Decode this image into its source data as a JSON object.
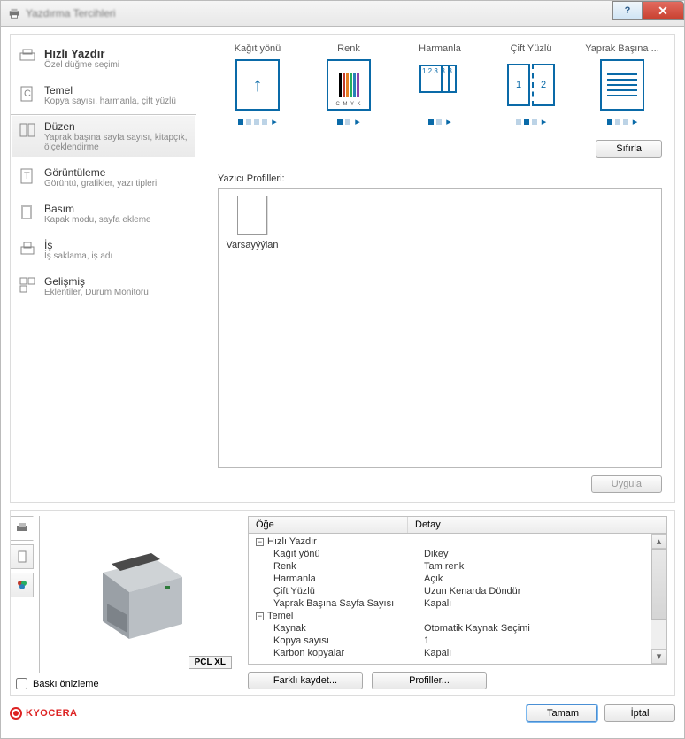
{
  "window": {
    "title": "Yazdırma Tercihleri"
  },
  "sidebar": {
    "items": [
      {
        "main": "Hızlı Yazdır",
        "sub": "Özel düğme seçimi"
      },
      {
        "main": "Temel",
        "sub": "Kopya sayısı, harmanla, çift yüzlü"
      },
      {
        "main": "Düzen",
        "sub": "Yaprak başına sayfa sayısı, kitapçık, ölçeklendirme"
      },
      {
        "main": "Görüntüleme",
        "sub": "Görüntü, grafikler, yazı tipleri"
      },
      {
        "main": "Basım",
        "sub": "Kapak modu, sayfa ekleme"
      },
      {
        "main": "İş",
        "sub": "İş saklama, iş adı"
      },
      {
        "main": "Gelişmiş",
        "sub": "Eklentiler, Durum Monitörü"
      }
    ]
  },
  "quick": {
    "items": [
      {
        "label": "Kağıt yönü"
      },
      {
        "label": "Renk"
      },
      {
        "label": "Harmanla"
      },
      {
        "label": "Çift Yüzlü"
      },
      {
        "label": "Yaprak Başına ..."
      }
    ],
    "reset_label": "Sıfırla"
  },
  "profiles": {
    "section_label": "Yazıcı Profilleri:",
    "default_name": "Varsayýýlan",
    "apply_label": "Uygula"
  },
  "summary": {
    "col1": "Öğe",
    "col2": "Detay",
    "groups": [
      {
        "name": "Hızlı Yazdır",
        "rows": [
          {
            "k": "Kağıt yönü",
            "v": "Dikey"
          },
          {
            "k": "Renk",
            "v": "Tam renk"
          },
          {
            "k": "Harmanla",
            "v": "Açık"
          },
          {
            "k": "Çift Yüzlü",
            "v": "Uzun Kenarda Döndür"
          },
          {
            "k": "Yaprak Başına Sayfa Sayısı",
            "v": "Kapalı"
          }
        ]
      },
      {
        "name": "Temel",
        "rows": [
          {
            "k": "Kaynak",
            "v": "Otomatik Kaynak Seçimi"
          },
          {
            "k": "Kopya sayısı",
            "v": "1"
          },
          {
            "k": "Karbon kopyalar",
            "v": "Kapalı"
          }
        ]
      }
    ]
  },
  "preview": {
    "driver_label": "PCL XL",
    "checkbox_label": "Baskı önizleme"
  },
  "buttons": {
    "save_as": "Farklı kaydet...",
    "profiles": "Profiller...",
    "ok": "Tamam",
    "cancel": "İptal"
  },
  "brand": "KYOCERA",
  "colors": {
    "accent": "#0a6aa8",
    "brand": "#d22"
  }
}
